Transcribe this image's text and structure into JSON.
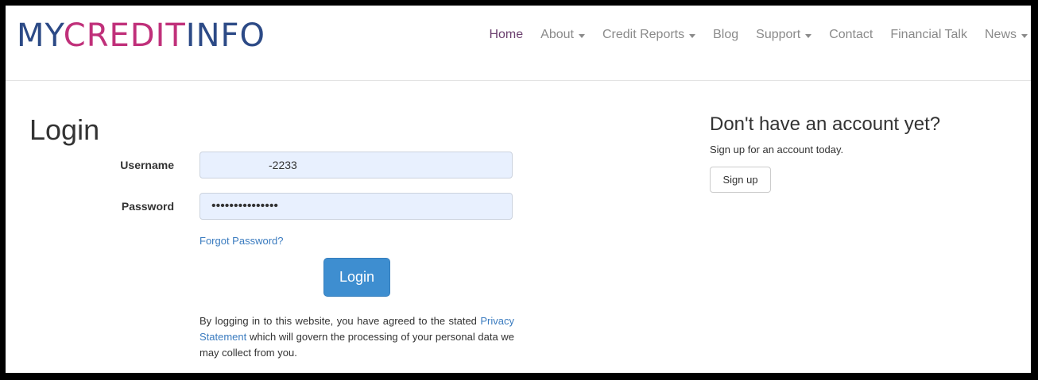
{
  "brand": {
    "part1": "MY",
    "part2": "CREDIT",
    "part3": "INFO"
  },
  "nav": {
    "items": [
      {
        "label": "Home",
        "dropdown": false,
        "active": true
      },
      {
        "label": "About",
        "dropdown": true
      },
      {
        "label": "Credit Reports",
        "dropdown": true
      },
      {
        "label": "Blog",
        "dropdown": false
      },
      {
        "label": "Support",
        "dropdown": true
      },
      {
        "label": "Contact",
        "dropdown": false
      },
      {
        "label": "Financial Talk",
        "dropdown": false
      },
      {
        "label": "News",
        "dropdown": true
      }
    ]
  },
  "login": {
    "title": "Login",
    "username_label": "Username",
    "username_value": "-2233",
    "password_label": "Password",
    "password_value": "•••••••••••••••",
    "forgot_label": "Forgot Password?",
    "button_label": "Login",
    "agreement_before": "By logging in to this website, you have agreed to the stated ",
    "agreement_link": "Privacy Statement",
    "agreement_after": " which will govern the processing of your personal data we may collect from you."
  },
  "signup": {
    "title": "Don't have an account yet?",
    "text": "Sign up for an account today.",
    "button_label": "Sign up"
  },
  "colors": {
    "brand_blue": "#2c4a86",
    "brand_pink": "#c0307a",
    "button_blue": "#3e8ed0",
    "link_blue": "#3a7bbf"
  }
}
